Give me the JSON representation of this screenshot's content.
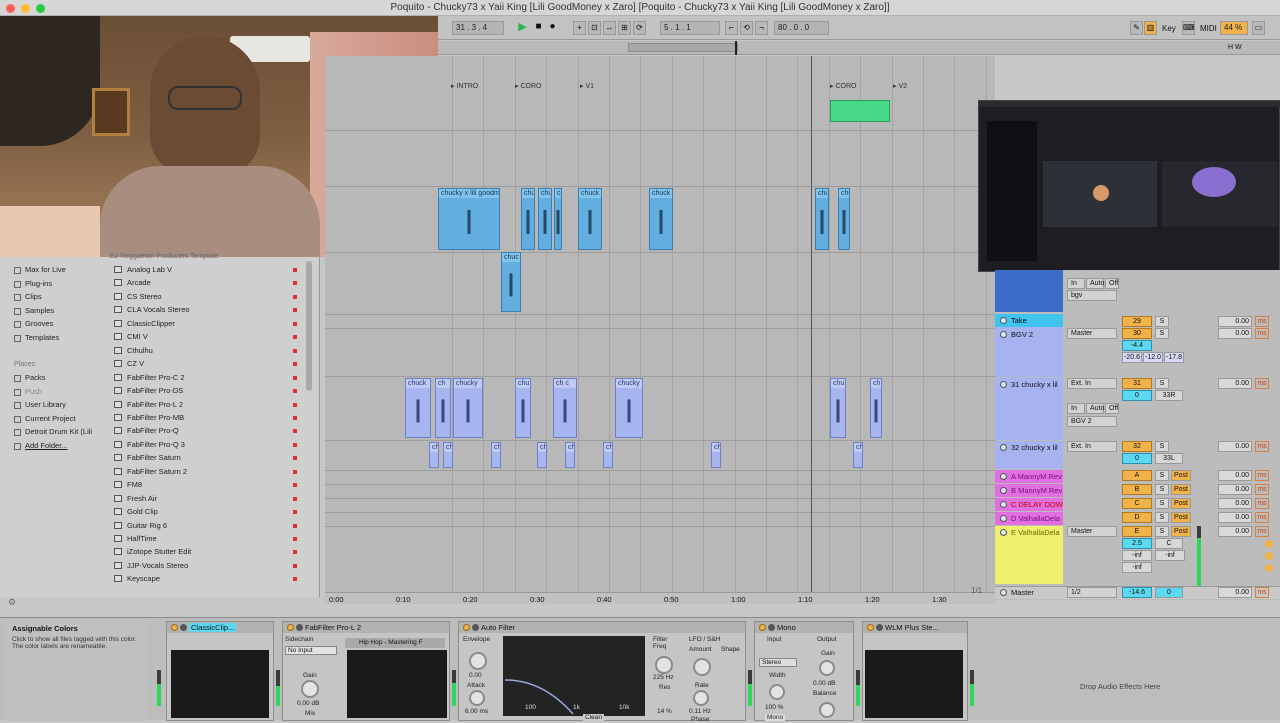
{
  "window": {
    "title": "Poquito - Chucky73 x Yaii King [Lili GoodMoney x Zaro]  [Poquito - Chucky73 x Yaii King [Lili GoodMoney x Zaro]]"
  },
  "transport": {
    "tempo": "31 . 3 . 4",
    "position": "5 . 1 . 1",
    "loop_length": "80 . 0 . 0",
    "key_label": "Key",
    "midi_label": "MIDI",
    "cpu": "44 %",
    "set_label": "Set"
  },
  "ruler": {
    "bars": [
      "9",
      "11",
      "13",
      "15",
      "17",
      "19",
      "21",
      "23",
      "25",
      "27",
      "29",
      "31",
      "33",
      "35",
      "37",
      "39",
      "41"
    ]
  },
  "locators": [
    "INTRO",
    "CORO",
    "V1",
    "CORO",
    "V2"
  ],
  "timeline": {
    "times": [
      "0:00",
      "0:10",
      "0:20",
      "0:30",
      "0:40",
      "0:50",
      "1:00",
      "1:10",
      "1:20",
      "1:30"
    ],
    "page": "1/1"
  },
  "clips": {
    "top_track": [
      "chucky x lili goodmon",
      "chu",
      "chu",
      "ch",
      "chuck",
      "chuck",
      "chu",
      "chu"
    ],
    "mid_clip": "chuc",
    "bgv_clips": [
      "chuck",
      "ch",
      "chucky",
      "chu",
      "ch c",
      "ch",
      "chucky",
      "chu",
      "ch"
    ],
    "bgv2_clips": [
      "ch",
      "ch",
      "ch",
      "ch",
      "ch",
      "ch",
      "ch",
      "ch"
    ]
  },
  "browser": {
    "categories": [
      "Max for Live",
      "Plug-ins",
      "Clips",
      "Samples",
      "Grooves",
      "Templates"
    ],
    "places_heading": "Places",
    "places": [
      "Packs",
      "Push",
      "User Library",
      "Current Project",
      "Detroit Drum Kit (Lili",
      "Add Folder..."
    ],
    "items": [
      "Analog Lab V",
      "Arcade",
      "CS Stereo",
      "CLA Vocals Stereo",
      "ClassicClipper",
      "CMI V",
      "Cthulhu",
      "CZ V",
      "FabFilter Pro-C 2",
      "FabFilter Pro-DS",
      "FabFilter Pro-L 2",
      "FabFilter Pro-MB",
      "FabFilter Pro-Q",
      "FabFilter Pro-Q 3",
      "FabFilter Saturn",
      "FabFilter Saturn 2",
      "FM8",
      "Fresh Air",
      "Gold Clip",
      "Guitar Rig 6",
      "HalfTime",
      "iZotope Stutter Edit",
      "JJP-Vocals Stereo",
      "Keyscape"
    ],
    "header_item": "Ez Reggaeton Producers Template"
  },
  "mixer": {
    "top_io": [
      "In",
      "Auto",
      "Off",
      "bgv"
    ],
    "tracks": [
      {
        "name": "Take",
        "color": "#3fc4f0",
        "io": "",
        "num": "",
        "val": "0.00",
        "highlight": true
      },
      {
        "name": "BGV 2",
        "color": "#a7b3f0",
        "io": "Master",
        "num": "30",
        "val": "0.00",
        "extra": [
          "-4.4",
          "-20.6",
          "-12.0",
          "-17.8",
          "-inf",
          "-inf"
        ]
      },
      {
        "name": "31 chucky x lil",
        "color": "#a7b3f0",
        "io": "Ext. In",
        "num": "31",
        "val": "0.00",
        "extra": [
          "0",
          "33R",
          "In",
          "Auto",
          "Off",
          "BGV 2",
          "-inf",
          "-inf"
        ]
      },
      {
        "name": "32 chucky x lil",
        "color": "#a7b3f0",
        "io": "Ext. In",
        "num": "32",
        "val": "0.00",
        "extra": [
          "0",
          "33L"
        ]
      },
      {
        "name": "A MannyM Rev",
        "color": "#e070e0",
        "io": "",
        "num": "A",
        "post": "Post",
        "val": "0.00"
      },
      {
        "name": "B MannyM Rev",
        "color": "#e070e0",
        "io": "",
        "num": "B",
        "post": "Post",
        "val": "0.00"
      },
      {
        "name": "C DELAY DOW",
        "color": "#e070e0",
        "io": "",
        "num": "C",
        "post": "Post",
        "val": "0.00"
      },
      {
        "name": "D ValhallaDela",
        "color": "#e070e0",
        "io": "",
        "num": "D",
        "post": "Post",
        "val": "0.00"
      },
      {
        "name": "E ValhallaDela",
        "color": "#f0f070",
        "io": "Master",
        "num": "E",
        "post": "Post",
        "val": "0.00",
        "extra": [
          "2.5",
          "C",
          "-inf",
          "-inf",
          "-inf"
        ]
      }
    ],
    "take_top_num": "29",
    "master": {
      "name": "Master",
      "io": "1/2",
      "vol": "-14.6",
      "pan": "0",
      "val": "0.00"
    },
    "solo": "S",
    "ms_unit": "ms"
  },
  "devices": {
    "info_title": "Assignable Colors",
    "info_text": "Click to show all files tagged with this color. The color labels are renameable.",
    "classic_clipper": "ClassicClip...",
    "pro_l2": "FabFilter Pro-L 2",
    "sidechain": "Sidechain",
    "no_input": "No Input",
    "gain": "Gain",
    "gain_val": "0.00 dB",
    "mix": "Mix",
    "preset": "Hip Hop - Mastering F",
    "auto_filter": "Auto Filter",
    "envelope": "Envelope",
    "attack": "Attack",
    "attack_val": "6.00 ms",
    "env_val": "0.00",
    "filter_freq": "Filter Freq",
    "freq_val": "225 Hz",
    "res": "Res",
    "res_val": "14 %",
    "lfo": "LFO / S&H",
    "amount": "Amount",
    "shape": "Shape",
    "rate": "Rate",
    "rate_val": "0.11 Hz",
    "phase": "Phase",
    "filter_axis": [
      "100",
      "1k",
      "10k"
    ],
    "clean": "Clean",
    "mono": "Mono",
    "input": "Input",
    "output": "Output",
    "stereo": "Stereo",
    "width": "Width",
    "width_val": "100 %",
    "out_gain": "Gain",
    "out_gain_val": "0.00 dB",
    "balance": "Balance",
    "mono_btn": "Mono",
    "wlm": "WLM Plus Ste...",
    "drop": "Drop Audio Effects Here"
  },
  "colors": {
    "accent": "#f2b24a",
    "clip_blue": "#62aee0",
    "clip_violet": "#a6b4ef",
    "green_meter": "#2ed65a",
    "cyan_take": "#3fc4f0"
  }
}
